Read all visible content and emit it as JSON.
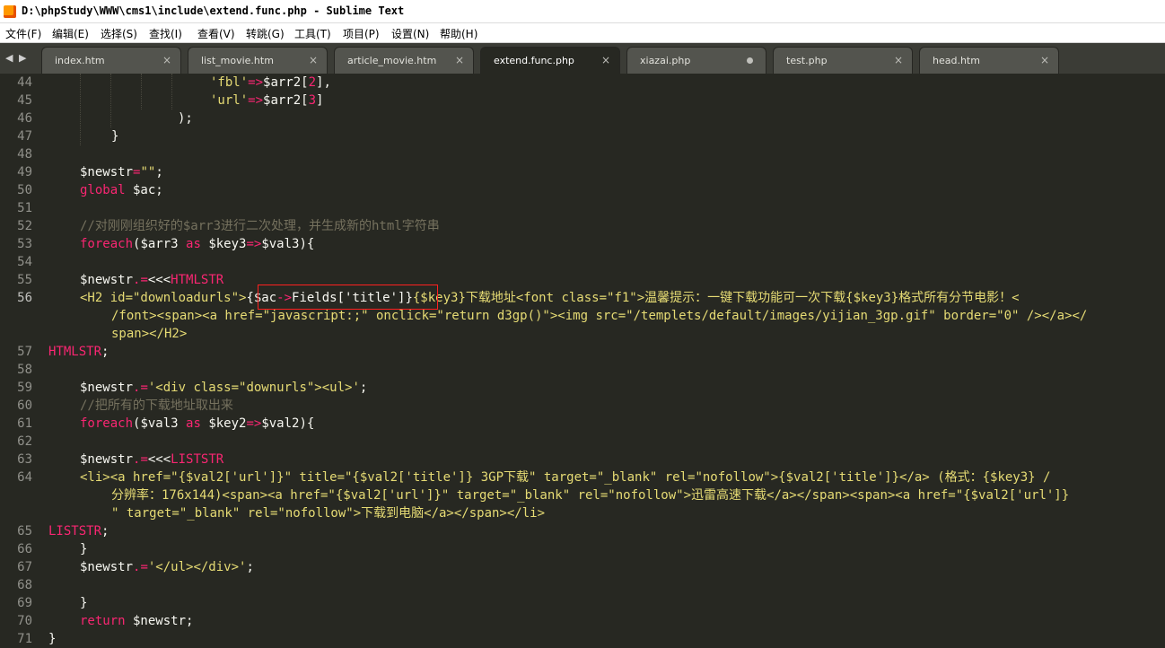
{
  "window": {
    "title": "D:\\phpStudy\\WWW\\cms1\\include\\extend.func.php - Sublime Text"
  },
  "menu": [
    "文件(F)",
    "编辑(E)",
    "选择(S)",
    "查找(I)",
    "查看(V)",
    "转跳(G)",
    "工具(T)",
    "项目(P)",
    "设置(N)",
    "帮助(H)"
  ],
  "tabs": [
    {
      "label": "index.htm",
      "close": "×"
    },
    {
      "label": "list_movie.htm",
      "close": "×"
    },
    {
      "label": "article_movie.htm",
      "close": "×"
    },
    {
      "label": "extend.func.php",
      "close": "×"
    },
    {
      "label": "xiazai.php",
      "close": ""
    },
    {
      "label": "test.php",
      "close": "×"
    },
    {
      "label": "head.htm",
      "close": "×"
    }
  ],
  "tab_nav": {
    "prev": "◀",
    "next": "▶"
  },
  "line_numbers": [
    "44",
    "45",
    "46",
    "47",
    "48",
    "49",
    "50",
    "51",
    "52",
    "53",
    "54",
    "55",
    "56",
    "",
    "",
    "57",
    "58",
    "59",
    "60",
    "61",
    "62",
    "63",
    "64",
    "",
    "",
    "65",
    "66",
    "67",
    "68",
    "69",
    "70",
    "71"
  ],
  "code": {
    "l44": [
      "'fbl'",
      "=>",
      "$arr2[",
      "2",
      "],"
    ],
    "l45": [
      "'url'",
      "=>",
      "$arr2[",
      "3",
      "]"
    ],
    "l46": [
      ");"
    ],
    "l47": [
      "}"
    ],
    "l49": [
      "$newstr",
      "=",
      "\"\"",
      ";"
    ],
    "l50": [
      "global",
      " $ac;"
    ],
    "l52": [
      "//对刚刚组织好的$arr3进行二次处理，并生成新的html字符串"
    ],
    "l53": [
      "foreach",
      "($arr3 ",
      "as",
      " $key3",
      "=>",
      "$val3){"
    ],
    "l55": [
      "$newstr",
      ".=",
      "<<<",
      "HTMLSTR"
    ],
    "l56a": [
      "<H2 id=\"downloadurls\">",
      "{$ac",
      "->",
      "Fields['title']}",
      "{$key3}下载地址<font class=\"f1\">温馨提示：一键下载功能可一次下载{$key3}格式所有分节电影！<"
    ],
    "l56b": [
      "/font><span><a href=\"javascript:;\" onclick=\"return d3gp()\"><img src=\"/templets/default/images/yijian_3gp.gif\" border=\"0\" /></a></"
    ],
    "l56c": [
      "span></H2>"
    ],
    "l57": [
      "HTMLSTR",
      ";"
    ],
    "l59": [
      "$newstr",
      ".=",
      "'<div class=\"downurls\"><ul>'",
      ";"
    ],
    "l60": [
      "//把所有的下载地址取出来"
    ],
    "l61": [
      "foreach",
      "($val3 ",
      "as",
      " $key2",
      "=>",
      "$val2){"
    ],
    "l63": [
      "$newstr",
      ".=",
      "<<<",
      "LISTSTR"
    ],
    "l64a": [
      "<li><a href=\"{$val2['url']}\" title=\"{$val2['title']} 3GP下载\" target=\"_blank\" rel=\"nofollow\">{$val2['title']}</a> (格式：{$key3} /"
    ],
    "l64b": [
      "分辨率：176x144)<span><a href=\"{$val2['url']}\" target=\"_blank\" rel=\"nofollow\">迅雷高速下载</a></span><span><a href=\"{$val2['url']}"
    ],
    "l64c": [
      "\" target=\"_blank\" rel=\"nofollow\">下载到电脑</a></span></li>"
    ],
    "l65": [
      "LISTSTR",
      ";"
    ],
    "l66": [
      "}"
    ],
    "l67": [
      "$newstr",
      ".=",
      "'</ul></div>'",
      ";"
    ],
    "l69": [
      "}"
    ],
    "l70": [
      "return",
      " $newstr;"
    ],
    "l71": [
      "}"
    ]
  },
  "colors": {
    "bg": "#272822",
    "string": "#e6db74",
    "keyword": "#f92672",
    "comment": "#75715e",
    "text": "#f8f8f2",
    "highlight_box": "#ff2020"
  }
}
